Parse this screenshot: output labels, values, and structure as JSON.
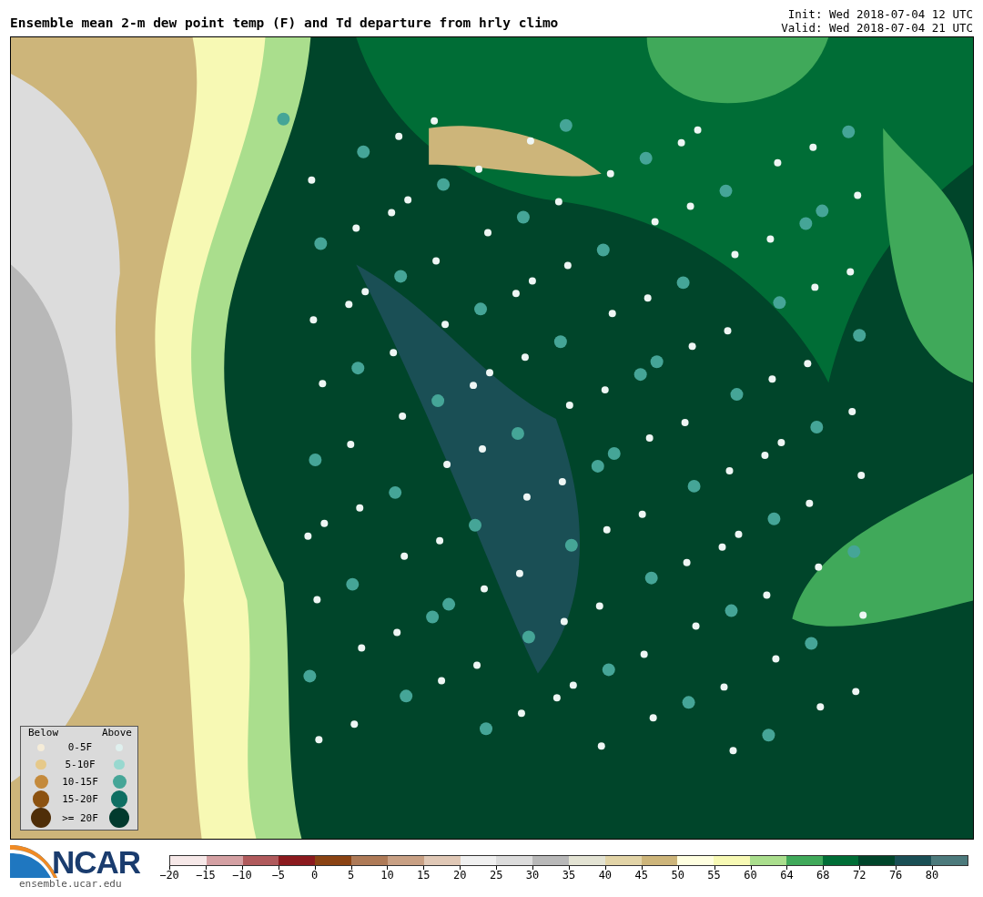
{
  "title": "Ensemble mean 2-m dew point temp (F) and Td departure from hrly climo",
  "init": "Init: Wed 2018-07-04 12 UTC",
  "valid": "Valid: Wed 2018-07-04 21 UTC",
  "legend": {
    "below_heading": "Below",
    "above_heading": "Above",
    "rows": [
      {
        "label": "0-5F",
        "below": {
          "color": "#f5ecd8"
        },
        "above": {
          "color": "#dff0ee"
        }
      },
      {
        "label": "5-10F",
        "below": {
          "color": "#e6c98a"
        },
        "above": {
          "color": "#98d8cf"
        }
      },
      {
        "label": "10-15F",
        "below": {
          "color": "#c48a3c"
        },
        "above": {
          "color": "#45a597"
        }
      },
      {
        "label": "15-20F",
        "below": {
          "color": "#8c5210"
        },
        "above": {
          "color": "#0e6e62"
        }
      },
      {
        "label": ">= 20F",
        "below": {
          "color": "#4f2e08"
        },
        "above": {
          "color": "#023a2e"
        }
      }
    ]
  },
  "logo": {
    "name": "NCAR",
    "url": "ensemble.ucar.edu"
  },
  "colorbar": [
    {
      "label": "−20",
      "color": "#f6e8e8"
    },
    {
      "label": "−15",
      "color": "#d4a0a3"
    },
    {
      "label": "−10",
      "color": "#b05a5c"
    },
    {
      "label": "−5",
      "color": "#8b1a1e"
    },
    {
      "label": "0",
      "color": "#8a4313"
    },
    {
      "label": "5",
      "color": "#ae7a57"
    },
    {
      "label": "10",
      "color": "#c8a084"
    },
    {
      "label": "15",
      "color": "#e0c8b6"
    },
    {
      "label": "20",
      "color": "#f0f0f0"
    },
    {
      "label": "25",
      "color": "#dcdcdc"
    },
    {
      "label": "30",
      "color": "#b8b8b8"
    },
    {
      "label": "35",
      "color": "#e3e3d3"
    },
    {
      "label": "40",
      "color": "#e2d4a7"
    },
    {
      "label": "45",
      "color": "#cdb57a"
    },
    {
      "label": "50",
      "color": "#ffffe0"
    },
    {
      "label": "55",
      "color": "#f7f9b4"
    },
    {
      "label": "60",
      "color": "#aade8d"
    },
    {
      "label": "64",
      "color": "#40a95a"
    },
    {
      "label": "68",
      "color": "#006d36"
    },
    {
      "label": "72",
      "color": "#00452a"
    },
    {
      "label": "76",
      "color": "#1a4f55"
    },
    {
      "label": "80",
      "color": "#4c7a7c"
    }
  ]
}
